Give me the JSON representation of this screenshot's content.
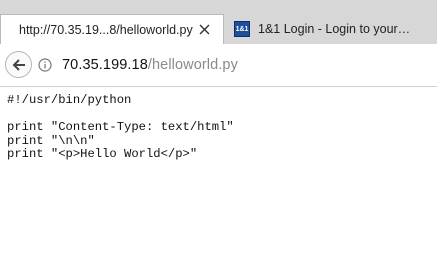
{
  "browser": {
    "tabs": [
      {
        "title": "http://70.35.19...8/helloworld.py",
        "active": true,
        "favicon": null
      },
      {
        "title": "1&1 Login - Login to your…",
        "active": false,
        "favicon": "1&1-logo-icon"
      }
    ],
    "favicon_text": "1&1",
    "address": {
      "host": "70.35.199.18",
      "path": "/helloworld.py"
    }
  },
  "page": {
    "lines": [
      "#!/usr/bin/python",
      "",
      "print \"Content-Type: text/html\"",
      "print \"\\n\\n\"",
      "print \"<p>Hello World</p>\""
    ]
  },
  "colors": {
    "tabstrip_bg": "#d7d7d7",
    "url_path": "#8a8a8a"
  }
}
